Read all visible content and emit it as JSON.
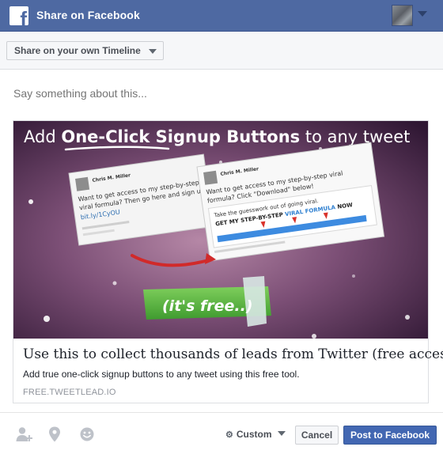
{
  "header": {
    "title": "Share on Facebook",
    "logo_letter": "f"
  },
  "audience": {
    "label": "Share on your own Timeline"
  },
  "composer": {
    "placeholder": "Say something about this..."
  },
  "preview": {
    "image": {
      "headline_prefix": "Add",
      "headline_emphasis": "One-Click Signup Buttons",
      "headline_suffix": "to any tweet",
      "ribbon_text": "(it's free..)",
      "tweet_left": {
        "author": "Chris M. Miller",
        "text_lines": [
          "Want to get access to my step-by-step",
          "viral formula? Then go here and sign up:"
        ],
        "link": "bit.ly/1CyOU"
      },
      "tweet_right": {
        "author": "Chris M. Miller",
        "text_lines": [
          "Want to get access to my step-by-step viral",
          "formula? Click \"Download\" below!"
        ],
        "card_line1": "Take the guesswork out of going viral.",
        "card_line2_prefix": "GET MY STEP-BY-STEP",
        "card_line2_link": "VIRAL FORMULA",
        "card_line2_suffix": "NOW"
      }
    },
    "title": "Use this to collect thousands of leads from Twitter (free access)",
    "description": "Add true one-click signup buttons to any tweet using this free tool.",
    "domain": "FREE.TWEETLEAD.IO"
  },
  "footer": {
    "icons": [
      "tag-friends-icon",
      "location-pin-icon",
      "feeling-smiley-icon"
    ],
    "privacy_label": "Custom",
    "cancel_label": "Cancel",
    "post_label": "Post to Facebook"
  },
  "colors": {
    "brand_blue": "#4e69a2",
    "post_button": "#4267b2",
    "ribbon_green": "#5cb85c"
  }
}
